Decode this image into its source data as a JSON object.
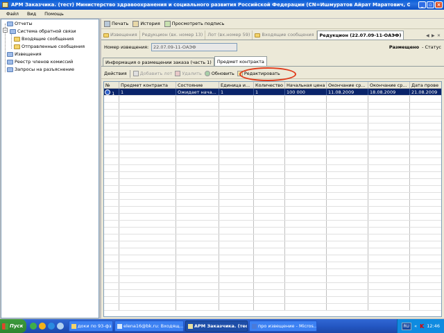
{
  "window": {
    "title": "АРМ Заказчика. (тест) Министерство здравоохранения и социального развития Российской Федерации (CN=Ишмуратов Айрат Маратович, OU=главный специал..."
  },
  "menu": [
    "Файл",
    "Вид",
    "Помощь"
  ],
  "tree": {
    "reports": "Отчеты",
    "feedback": "Система обратной связи",
    "inbox": "Входящие сообщения",
    "sent": "Отправленные сообщения",
    "notices": "Извещения",
    "commission": "Реестр членов комиссий",
    "requests": "Запросы на разъяснение"
  },
  "toolbar": {
    "print": "Печать",
    "history": "История",
    "view_sign": "Просмотреть подпись"
  },
  "doc_tabs": [
    "Извещения",
    "Редукцион (вх. номер 13)",
    "Лот (вх.номер 59)",
    "Входящие сообщения",
    "Редукцион (22.07.09-11-ОАЭФ)"
  ],
  "notice": {
    "label": "Номер извещения:",
    "value": "22.07.09-11-ОАЭФ",
    "status_value": "Размещено",
    "status_label": "- Статус"
  },
  "sub_tabs": [
    "Информация о размещении заказа (часть 1)",
    "Предмет контракта"
  ],
  "actions": {
    "actions": "Действия",
    "add_lot": "Добавить лот",
    "delete": "Удалить",
    "refresh": "Обновить",
    "edit": "Редактировать"
  },
  "grid": {
    "columns": [
      "№",
      "Предмет контракта",
      "Состояние",
      "Единица и...",
      "Количество",
      "Начальная цена",
      "Окончание ср...",
      "Окончание ср...",
      "Дата прове"
    ],
    "rows": [
      [
        "1",
        "1",
        "Ожидает нача...",
        "1",
        "1",
        "100 000",
        "11.08.2009",
        "18.08.2009",
        "21.08.2009"
      ]
    ]
  },
  "taskbar": {
    "start": "Пуск",
    "tasks": [
      "доки по 93-фз",
      "elena16@bk.ru: Входящ...",
      "АРМ Заказчика. (тес...",
      "про извещение - Micros..."
    ],
    "lang": "RU",
    "time": "12:46"
  }
}
